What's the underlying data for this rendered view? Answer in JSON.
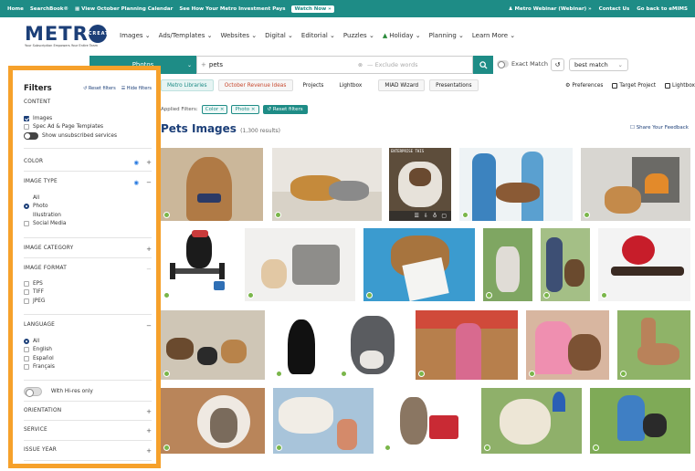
{
  "topbar": {
    "home": "Home",
    "searchbook": "SearchBook®",
    "calendar": "View October Planning Calendar",
    "investment": "See How Your Metro Investment Pays",
    "watch_now": "Watch Now »",
    "webinar": "Metro Webinar (Webinar) »",
    "contact": "Contact Us",
    "goback": "Go back to eMIMS"
  },
  "logo": {
    "word_left": "METR",
    "word_o": "CREATIVE",
    "tagline": "Your Subscription Empowers Your Entire Team"
  },
  "nav": [
    "Images",
    "Ads/Templates",
    "Websites",
    "Digital",
    "Editorial",
    "Puzzles",
    "Holiday",
    "Planning",
    "Learn More"
  ],
  "search": {
    "category": "Photos",
    "query": "pets",
    "exclude_placeholder": "Exclude words",
    "exact_match": "Exact Match",
    "sort": "best match"
  },
  "tabs": [
    "Metro Libraries",
    "October Revenue Ideas",
    "Projects",
    "Lightbox",
    "MIAD Wizard",
    "Presentations"
  ],
  "tabs_right": [
    "Preferences",
    "Target Project",
    "Lightbox"
  ],
  "applied": {
    "label": "Applied Filters:",
    "chips": [
      "Color ×",
      "Photo ×"
    ],
    "reset": "Reset filters"
  },
  "results": {
    "title": "Pets Images",
    "count": "(1,300 results)",
    "feedback": "Share Your Feedback"
  },
  "sidebar": {
    "title": "Filters",
    "reset": "Reset filters",
    "hide": "Hide filters",
    "content_label": "CONTENT",
    "content_opts": [
      "Images",
      "Spec Ad & Page Templates"
    ],
    "unsubscribed": "Show unsubscribed services",
    "color": "COLOR",
    "image_type": "IMAGE TYPE",
    "image_type_opts": [
      "All",
      "Photo",
      "Illustration",
      "Social Media"
    ],
    "image_category": "IMAGE CATEGORY",
    "image_format": "IMAGE FORMAT",
    "format_opts": [
      "EPS",
      "TIFF",
      "JPEG"
    ],
    "language": "LANGUAGE",
    "language_opts": [
      "All",
      "English",
      "Español",
      "Français"
    ],
    "hires": "With Hi-res only",
    "orientation": "ORIENTATION",
    "service": "SERVICE",
    "issue_year": "ISSUE YEAR"
  },
  "image_caption": "ENTERPRISE THIS",
  "colors": {
    "teal": "#1e8c86",
    "navy": "#1c3f78",
    "orange": "#f6a12b",
    "red": "#c8482e"
  }
}
